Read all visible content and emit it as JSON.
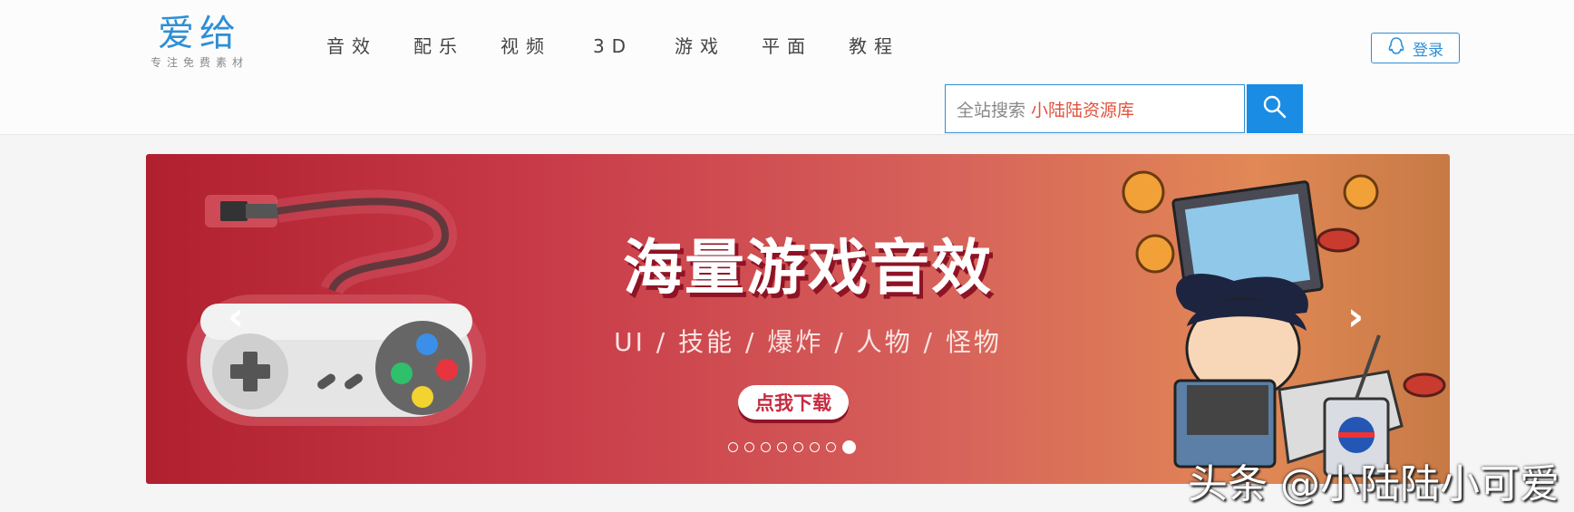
{
  "logo": {
    "main": "爱给",
    "tagline": "专注免费素材"
  },
  "nav": {
    "items": [
      "音效",
      "配乐",
      "视频",
      "3D",
      "游戏",
      "平面",
      "教程"
    ]
  },
  "login": {
    "label": "登录",
    "icon": "qq-penguin-icon"
  },
  "search": {
    "placeholder": "全站搜索",
    "hot_keyword": "小陆陆资源库",
    "button_icon": "search-icon"
  },
  "banner": {
    "title": "海量游戏音效",
    "subtitle": "UI / 技能 / 爆炸 / 人物 / 怪物",
    "cta": "点我下载",
    "slide_count": 8,
    "active_slide": 8,
    "prev_icon": "chevron-left-icon",
    "next_icon": "chevron-right-icon"
  },
  "watermark": "头条 @小陆陆小可爱",
  "colors": {
    "brand_blue": "#2e8fd6",
    "search_button": "#1a8ce4",
    "hot_keyword": "#e0533d",
    "banner_red": "#c83a48"
  }
}
